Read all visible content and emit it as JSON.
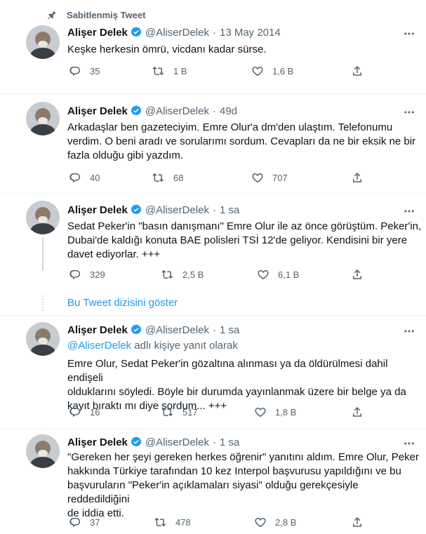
{
  "pinned_label": "Sabitlenmiş Tweet",
  "show_thread_label": "Bu Tweet dizisini göster",
  "colors": {
    "accent": "#1d9bf0",
    "muted": "#536471",
    "text": "#0f1419",
    "divider": "#eff3f4"
  },
  "tweets": [
    {
      "name": "Alişer Delek",
      "handle": "@AliserDelek",
      "dot": "·",
      "time": "13 May 2014",
      "text": "Keşke herkesin ömrü, vicdanı kadar sürse.",
      "replies": "35",
      "retweets": "1 B",
      "likes": "1,6 B"
    },
    {
      "name": "Alişer Delek",
      "handle": "@AliserDelek",
      "dot": "·",
      "time": "49d",
      "text": "Arkadaşlar ben gazeteciyim. Emre Olur'a dm'den ulaştım. Telefonumu\nverdim. O beni aradı ve sorularımı sordum. Cevapları da ne bir eksik ne bir\nfazla olduğu gibi yazdım.",
      "replies": "40",
      "retweets": "68",
      "likes": "707"
    },
    {
      "name": "Alişer Delek",
      "handle": "@AliserDelek",
      "dot": "·",
      "time": "1 sa",
      "text": "Sedat Peker'in \"basın danışmanı\" Emre Olur ile az önce görüştüm. Peker'in,\nDubai'de kaldığı konuta BAE polisleri TSİ 12'de geliyor. Kendisini bir yere\ndavet ediyorlar.  +++",
      "replies": "329",
      "retweets": "2,5 B",
      "likes": "6,1 B"
    },
    {
      "name": "Alişer Delek",
      "handle": "@AliserDelek",
      "dot": "·",
      "time": "1 sa",
      "reply_mention": "@AliserDelek",
      "reply_suffix": " adlı kişiye yanıt olarak",
      "text": "Emre Olur, Sedat Peker'in gözaltına alınması ya da öldürülmesi dahil endişeli\nolduklarını söyledi. Böyle bir durumda yayınlanmak üzere bir belge ya da\nkayıt bıraktı mı diye sordum... +++",
      "replies": "16",
      "retweets": "517",
      "likes": "1,8 B"
    },
    {
      "name": "Alişer Delek",
      "handle": "@AliserDelek",
      "dot": "·",
      "time": "1 sa",
      "text": "\"Gereken her şeyi gereken herkes öğrenir\" yanıtını aldım. Emre Olur, Peker\nhakkında Türkiye tarafından 10 kez Interpol başvurusu yapıldığını ve bu\nbaşvuruların \"Peker'in açıklamaları siyasi\" olduğu gerekçesiyle reddedildiğini\nde iddia etti.",
      "replies": "37",
      "retweets": "478",
      "likes": "2,8 B"
    }
  ]
}
